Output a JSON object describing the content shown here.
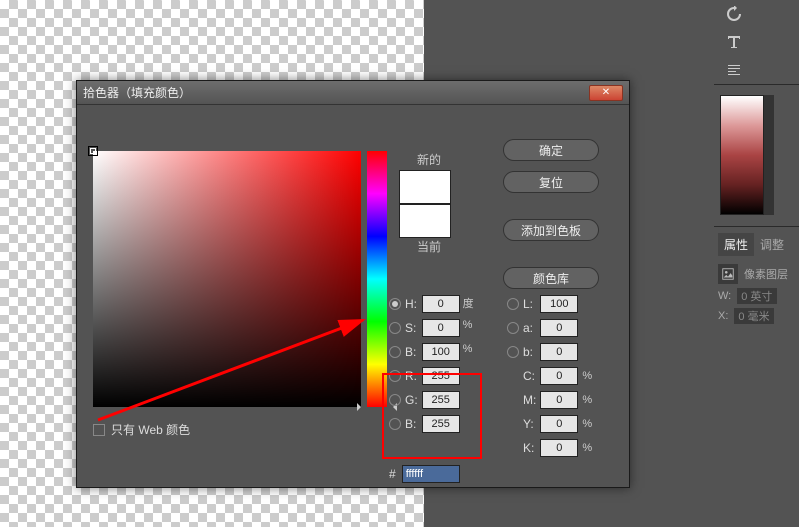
{
  "dialog": {
    "title": "拾色器（填充颜色）",
    "swatch": {
      "new_label": "新的",
      "current_label": "当前"
    },
    "buttons": {
      "ok": "确定",
      "reset": "复位",
      "add_swatch": "添加到色板",
      "color_lib": "颜色库"
    },
    "values": {
      "h": {
        "label": "H:",
        "val": "0",
        "unit": "度"
      },
      "s": {
        "label": "S:",
        "val": "0",
        "unit": "%"
      },
      "bb": {
        "label": "B:",
        "val": "100",
        "unit": "%"
      },
      "r": {
        "label": "R:",
        "val": "255"
      },
      "g": {
        "label": "G:",
        "val": "255"
      },
      "b": {
        "label": "B:",
        "val": "255"
      },
      "l": {
        "label": "L:",
        "val": "100"
      },
      "a": {
        "label": "a:",
        "val": "0"
      },
      "bb2": {
        "label": "b:",
        "val": "0"
      },
      "c": {
        "label": "C:",
        "val": "0",
        "unit": "%"
      },
      "m": {
        "label": "M:",
        "val": "0",
        "unit": "%"
      },
      "y": {
        "label": "Y:",
        "val": "0",
        "unit": "%"
      },
      "k": {
        "label": "K:",
        "val": "0",
        "unit": "%"
      }
    },
    "hex": {
      "label": "#",
      "val": "ffffff"
    },
    "web_only": "只有 Web 颜色"
  },
  "right": {
    "tabs": {
      "props": "属性",
      "adjust": "调整"
    },
    "kind": "像素图层",
    "w": {
      "label": "W:",
      "val": "0 英寸"
    },
    "x": {
      "label": "X:",
      "val": "0 毫米"
    }
  }
}
